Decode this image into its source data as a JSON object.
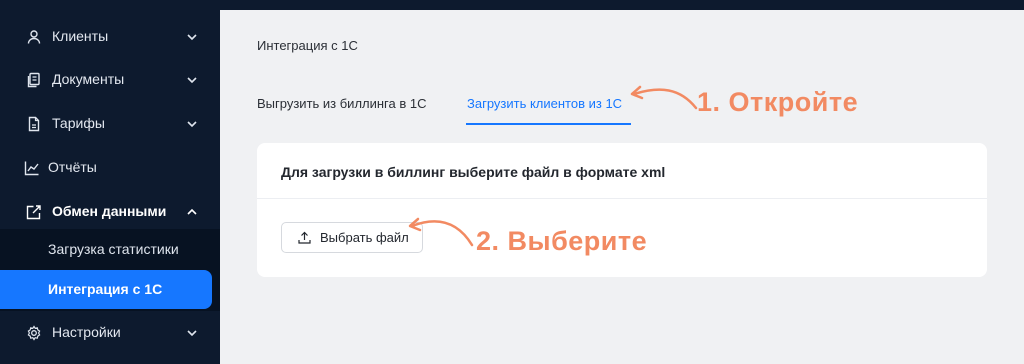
{
  "sidebar": {
    "items": [
      {
        "label": "Клиенты",
        "icon": "user-icon"
      },
      {
        "label": "Документы",
        "icon": "documents-icon"
      },
      {
        "label": "Тарифы",
        "icon": "tariff-icon"
      },
      {
        "label": "Отчёты",
        "icon": "chart-icon"
      },
      {
        "label": "Обмен данными",
        "icon": "exchange-icon"
      },
      {
        "label": "Настройки",
        "icon": "gear-icon"
      }
    ],
    "sub_items": [
      {
        "label": "Загрузка статистики"
      },
      {
        "label": "Интеграция с 1С"
      }
    ]
  },
  "page": {
    "title": "Интеграция с 1С",
    "tabs": [
      {
        "label": "Выгрузить из биллинга в 1С"
      },
      {
        "label": "Загрузить клиентов из 1С"
      }
    ]
  },
  "card": {
    "title": "Для загрузки в биллинг выберите файл в формате xml",
    "button_label": "Выбрать файл"
  },
  "annotations": {
    "step1": "1. Откройте",
    "step2": "2. Выберите"
  },
  "colors": {
    "sidebar_bg": "#0d1a2e",
    "accent": "#1677ff",
    "annotation": "#f28a62"
  }
}
